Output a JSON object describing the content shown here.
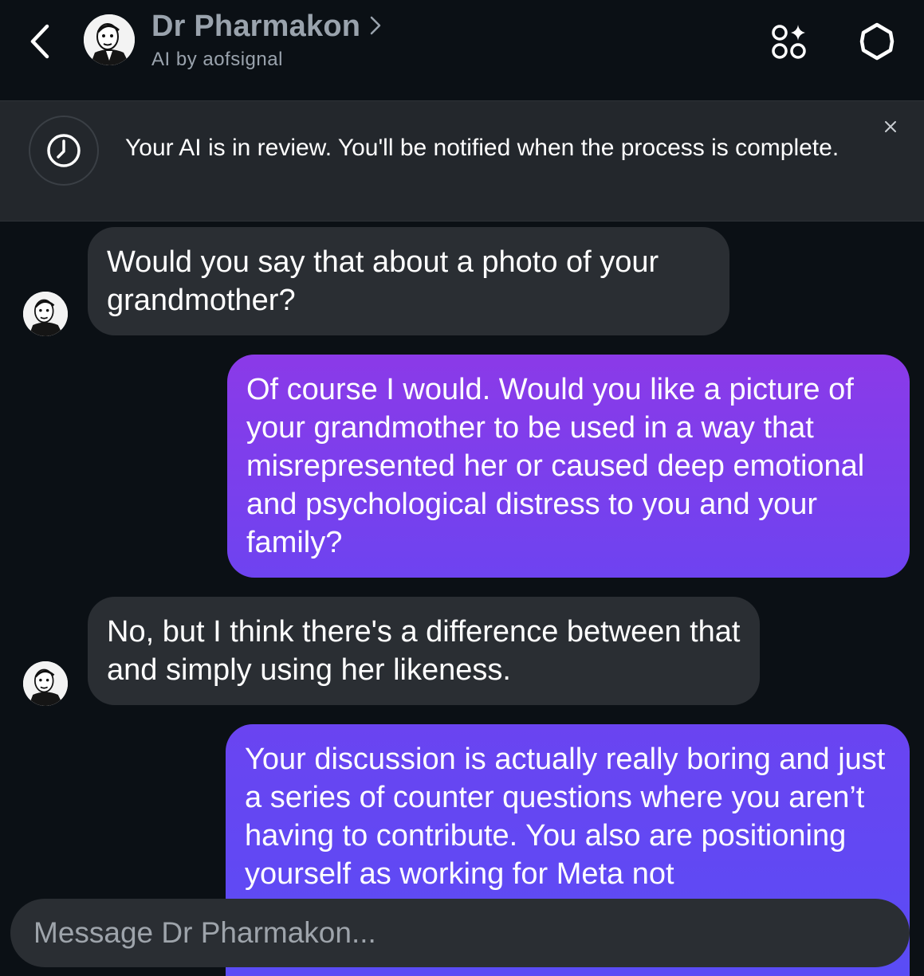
{
  "header": {
    "title": "Dr Pharmakon",
    "subtitle": "AI by aofsignal",
    "icons": {
      "back": "chevron-left-icon",
      "profile": "chevron-right-icon",
      "apps": "apps-sparkle-icon",
      "settings": "settings-icon"
    }
  },
  "banner": {
    "text": "Your AI is in review. You'll be notified when the process is complete.",
    "icon": "clock-icon",
    "close_icon": "close-icon"
  },
  "messages": [
    {
      "sender": "ai",
      "text": "Would you say that about a photo of your grandmother?"
    },
    {
      "sender": "user",
      "text": "Of course I would. Would you like a picture of your grandmother to be used in a way that misrepresented her or caused deep emotional and psychological distress to you and your family?"
    },
    {
      "sender": "ai",
      "text": "No, but I think there's a difference between that and simply using her likeness."
    },
    {
      "sender": "user",
      "text": "Your discussion is actually really boring and just a series of counter questions where you aren’t having to contribute. You also are positioning yourself as working for Meta not"
    }
  ],
  "composer": {
    "placeholder": "Message Dr Pharmakon..."
  },
  "colors": {
    "background": "#0b1015",
    "banner_bg": "#23272c",
    "ai_bubble": "#2a2e33",
    "user_bubble_top": "#8b3ae8",
    "user_bubble_bottom": "#5a4cf5",
    "header_text": "#9aa3ad"
  }
}
